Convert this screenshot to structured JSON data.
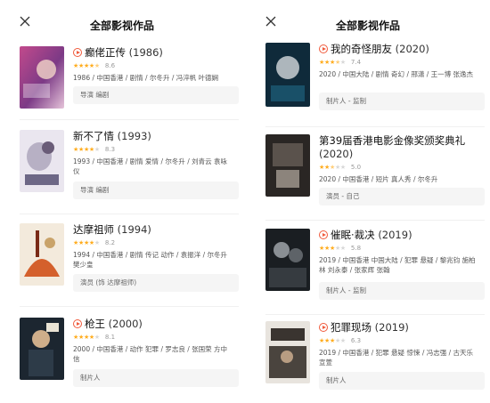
{
  "left": {
    "title": "全部影视作品",
    "items": [
      {
        "name": "癫佬正传",
        "year": "(1986)",
        "score": "8.6",
        "stars": 4.5,
        "meta": "1986 / 中国香港 / 剧情 / 尔冬升 / 冯淬帆 叶德娴",
        "role": "导演  编剧",
        "has_play": true
      },
      {
        "name": "新不了情",
        "year": "(1993)",
        "score": "8.3",
        "stars": 4,
        "meta": "1993 / 中国香港 / 剧情 爱情 / 尔冬升 / 刘青云 袁咏仪",
        "role": "导演  编剧",
        "has_play": false
      },
      {
        "name": "达摩祖师",
        "year": "(1994)",
        "score": "8.2",
        "stars": 4,
        "meta": "1994 / 中国香港 / 剧情 传记 动作 / 袁振洋 / 尔冬升 樊少皇",
        "role": "演员 (饰 达摩祖师)",
        "has_play": false
      },
      {
        "name": "枪王",
        "year": "(2000)",
        "score": "8.1",
        "stars": 4,
        "meta": "2000 / 中国香港 / 动作 犯罪 / 罗志良 / 张国荣 方中信",
        "role": "制片人",
        "has_play": true
      }
    ]
  },
  "right": {
    "title": "全部影视作品",
    "items": [
      {
        "name": "我的奇怪朋友",
        "year": "(2020)",
        "score": "7.4",
        "stars": 3.5,
        "meta": "2020 / 中国大陆 / 剧情 奇幻 / 邢潇 / 王一博 张逸杰",
        "role": "制片人 - 监制",
        "has_play": true
      },
      {
        "name": "第39届香港电影金像奖颁奖典礼",
        "year": "(2020)",
        "score": "5.0",
        "stars": 2.5,
        "meta": "2020 / 中国香港 / 短片 真人秀 / 尔冬升",
        "role": "演员 - 自己",
        "has_play": false
      },
      {
        "name": "催眠·裁决",
        "year": "(2019)",
        "score": "5.8",
        "stars": 3,
        "meta": "2019 / 中国香港 中国大陆 / 犯罪 悬疑 / 黎兆钧 施柏林 刘永泰 / 张家辉 张翰",
        "role": "制片人 - 监制",
        "has_play": true
      },
      {
        "name": "犯罪现场",
        "year": "(2019)",
        "score": "6.3",
        "stars": 3,
        "meta": "2019 / 中国香港 / 犯罪 悬疑 惊悚 / 冯志强 / 古天乐 宣萱",
        "role": "制片人",
        "has_play": true
      }
    ]
  }
}
